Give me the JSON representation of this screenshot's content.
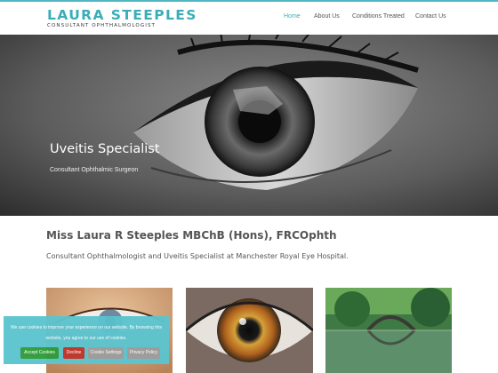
{
  "logo": {
    "name": "LAURA STEEPLES",
    "subtitle": "CONSULTANT OPHTHALMOLOGIST"
  },
  "nav": {
    "items": [
      {
        "label": "Home",
        "active": true
      },
      {
        "label": "About Us",
        "active": false
      },
      {
        "label": "Conditions Treated",
        "active": false
      },
      {
        "label": "Contact Us",
        "active": false
      }
    ]
  },
  "hero": {
    "title": "Uveitis Specialist",
    "subtitle": "Consultant Ophthalmic Surgeon"
  },
  "intro": {
    "title": "Miss Laura R Steeples MBChB (Hons), FRCOphth",
    "text": "Consultant Ophthalmologist and Uveitis Specialist at Manchester Royal Eye Hospital."
  },
  "cookie": {
    "message": "We use cookies to improve your experience on our website. By browsing this website, you agree to our use of cookies.",
    "accept": "Accept Cookies",
    "decline": "Decline",
    "settings": "Cookie Settings",
    "policy": "Privacy Policy"
  },
  "colors": {
    "accent": "#3aaeb8",
    "cookie_bg": "#5cc4cf",
    "accept": "#2f9c39",
    "decline": "#c0362c",
    "neutral": "#9e9e9e"
  }
}
